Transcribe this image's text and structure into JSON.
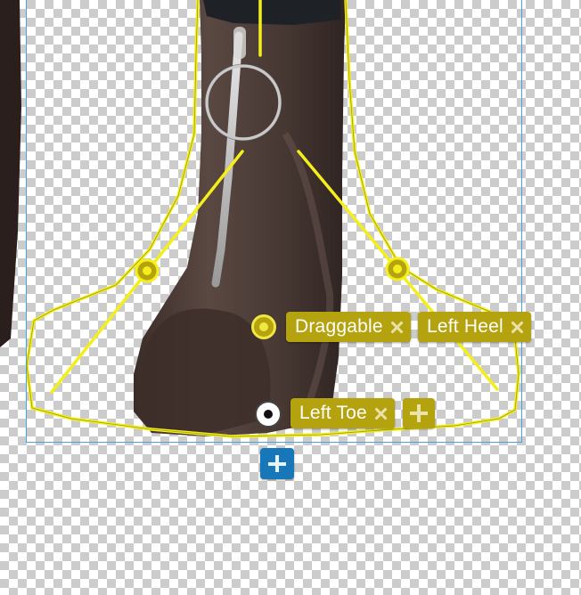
{
  "canvas": {
    "subject": "boot",
    "handle_color": "#f0e842",
    "bounds_color": "#4aa3df"
  },
  "tags": {
    "draggable": {
      "label": "Draggable",
      "remove_icon": "close-icon"
    },
    "left_heel": {
      "label": "Left Heel",
      "remove_icon": "close-icon"
    },
    "left_toe": {
      "label": "Left Toe",
      "remove_icon": "close-icon"
    }
  },
  "buttons": {
    "add_tag_icon": "plus-icon",
    "add_tag_color": "#b4a20e",
    "add_pin_icon": "plus-icon",
    "add_pin_color": "#1877b9"
  }
}
